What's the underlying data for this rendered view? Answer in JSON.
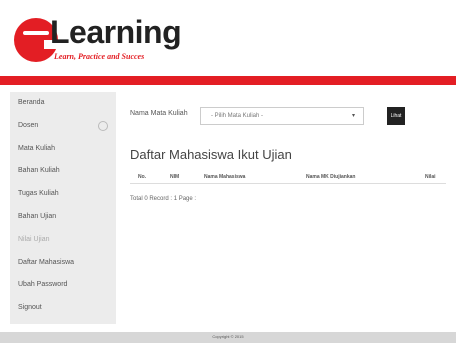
{
  "logo": {
    "word": "Learning",
    "tagline": "Learn, Practice and Succes"
  },
  "colors": {
    "accent": "#e31e24",
    "sidebar_bg": "#ececec",
    "footer_bg": "#d7d7d7",
    "button_bg": "#222222"
  },
  "sidebar": {
    "items": [
      {
        "label": "Beranda"
      },
      {
        "label": "Dosen"
      },
      {
        "label": "Mata Kuliah"
      },
      {
        "label": "Bahan Kuliah"
      },
      {
        "label": "Tugas Kuliah"
      },
      {
        "label": "Bahan Ujian"
      },
      {
        "label": "Nilai Ujian"
      },
      {
        "label": "Daftar Mahasiswa"
      },
      {
        "label": "Ubah Password"
      },
      {
        "label": "Signout"
      }
    ]
  },
  "form": {
    "label": "Nama Mata Kuliah",
    "select_value": "- Pilih Mata Kuliah -",
    "button_label": "Lihat"
  },
  "main": {
    "title": "Daftar Mahasiswa Ikut Ujian",
    "columns": [
      "No.",
      "NIM",
      "Nama Mahasiswa",
      "Nama MK Diujiankan",
      "Nilai"
    ],
    "record_text": "Total 0 Record : 1 Page :"
  },
  "footer": {
    "text": "Copyright © 2015"
  }
}
